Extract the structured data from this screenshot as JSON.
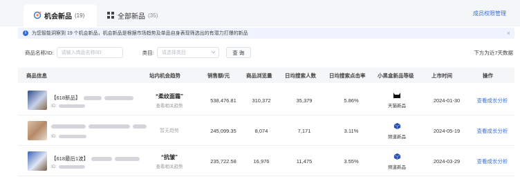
{
  "tabs": [
    {
      "label": "机会新品",
      "count": "(19)",
      "icon": "target-icon"
    },
    {
      "label": "全部新品",
      "count": "(35)",
      "icon": "grid-icon"
    }
  ],
  "manage_link": "成员权限管理",
  "notice": {
    "text": "为您智能洞察到 19 个机会新品，机会新品是根据市场趋势及单品自身表现筛选出的有潜力打爆的新品",
    "close": "×"
  },
  "filters": {
    "name_label": "商品名称/ID:",
    "name_placeholder": "请输入商品名称/ID",
    "category_label": "类目:",
    "category_placeholder": "请选择类目",
    "query_button": "查 询",
    "range_text": "下方为近7天数据"
  },
  "table": {
    "headers": [
      "商品信息",
      "站内机会趋势",
      "销售额/元",
      "商品浏览量",
      "日均搜索人数",
      "日均搜索点击率",
      "小黑盒新品等级",
      "上市时间",
      "操作"
    ],
    "rows": [
      {
        "title_prefix": "【618新品】",
        "id_prefix": "ID:",
        "trend_keyword": "“柔纹面霜”",
        "trend_sub": "查看相关趋势",
        "sales": "538,476.81",
        "views": "310,372",
        "searchers": "35,379",
        "ctr": "5.86%",
        "grade": "天猫新品",
        "grade_icon": "cat-head-icon",
        "date": "2024-01-30",
        "action": "查看成长分析"
      },
      {
        "title_prefix": "",
        "id_prefix": "ID:",
        "trend_none": "暂无趋势",
        "sales": "245,099.35",
        "views": "8,074",
        "searchers": "7,171",
        "ctr": "3.11%",
        "grade": "频道新品",
        "grade_icon": "cube-icon",
        "date": "2024-05-19",
        "action": "查看成长分析"
      },
      {
        "title_prefix": "【618最后1波】",
        "id_prefix": "ID:",
        "trend_keyword": "“抗皱”",
        "trend_sub": "查看相关趋势",
        "sales": "235,722.58",
        "views": "16,976",
        "searchers": "11,475",
        "ctr": "3.55%",
        "grade": "频道新品",
        "grade_icon": "cube-icon",
        "date": "2024-03-29",
        "action": "查看成长分析"
      }
    ]
  },
  "colors": {
    "accent": "#3a6fd8",
    "notice_bg": "#eef3ff",
    "header_bg": "#f5f6f8"
  }
}
